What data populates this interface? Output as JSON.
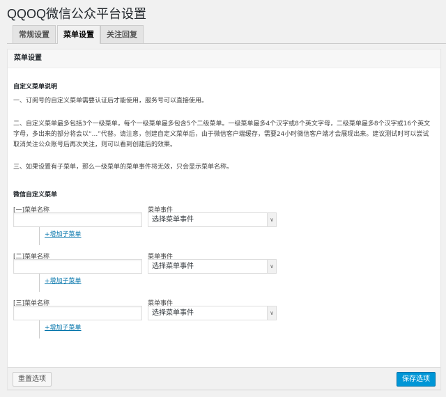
{
  "title": "QQOQ微信公众平台设置",
  "tabs": [
    "常规设置",
    "菜单设置",
    "关注回复"
  ],
  "panel_title": "菜单设置",
  "desc_heading": "自定义菜单说明",
  "desc": [
    "一、订阅号的自定义菜单需要认证后才能使用，服务号可以直接使用。",
    "二、自定义菜单最多包括3个一级菜单，每个一级菜单最多包含5个二级菜单。一级菜单最多4个汉字或8个英文字母，二级菜单最多8个汉字或16个英文字母，多出来的部分将会以“...”代替。请注意，创建自定义菜单后，由于微信客户端缓存，需要24小时微信客户端才会展现出来。建议测试时可以尝试取消关注公众账号后再次关注，则可以看到创建后的效果。",
    "三、如果设置有子菜单，那么一级菜单的菜单事件将无效，只会显示菜单名称。"
  ],
  "menu_heading": "微信自定义菜单",
  "menus": [
    {
      "name_label": "[一]菜单名称",
      "name_value": "",
      "event_label": "菜单事件",
      "event_value": "选择菜单事件",
      "add_sub": "+增加子菜单"
    },
    {
      "name_label": "[二]菜单名称",
      "name_value": "",
      "event_label": "菜单事件",
      "event_value": "选择菜单事件",
      "add_sub": "+增加子菜单"
    },
    {
      "name_label": "[三]菜单名称",
      "name_value": "",
      "event_label": "菜单事件",
      "event_value": "选择菜单事件",
      "add_sub": "+增加子菜单"
    }
  ],
  "footer": {
    "reset": "重置选项",
    "save": "保存选项"
  }
}
